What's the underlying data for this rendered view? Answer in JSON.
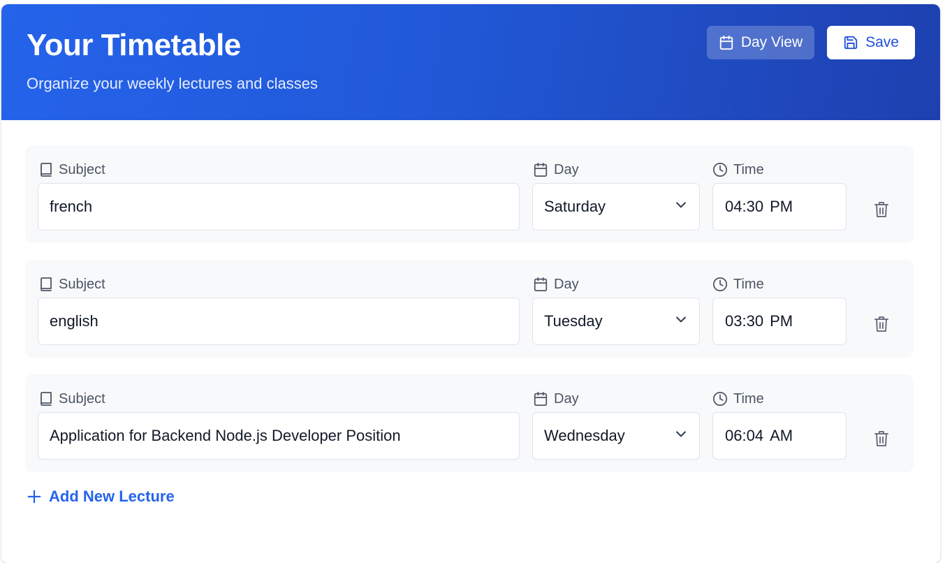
{
  "header": {
    "title": "Your Timetable",
    "subtitle": "Organize your weekly lectures and classes",
    "day_view_label": "Day View",
    "save_label": "Save"
  },
  "labels": {
    "subject": "Subject",
    "day": "Day",
    "time": "Time"
  },
  "lectures": [
    {
      "subject": "french",
      "day": "Saturday",
      "time": "04:30",
      "meridiem": "PM"
    },
    {
      "subject": "english",
      "day": "Tuesday",
      "time": "03:30",
      "meridiem": "PM"
    },
    {
      "subject": "Application for Backend Node.js Developer Position",
      "day": "Wednesday",
      "time": "06:04",
      "meridiem": "AM"
    }
  ],
  "add_label": "Add New Lecture",
  "colors": {
    "header_start": "#2563eb",
    "header_end": "#1e40af",
    "accent": "#2563eb",
    "row_background": "#f8f9fb"
  },
  "icons": {
    "day_view": "calendar-icon",
    "save": "save-icon",
    "subject": "book-icon",
    "day": "calendar-icon",
    "time": "clock-icon",
    "day_select": "chevron-down-icon",
    "delete": "trash-icon",
    "add": "plus-icon"
  }
}
